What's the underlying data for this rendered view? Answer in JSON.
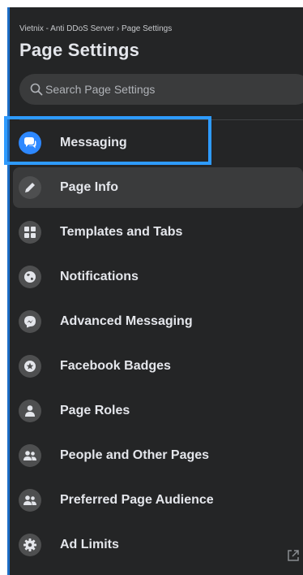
{
  "header": {
    "breadcrumb": "Vietnix - Anti DDoS Server › Page Settings",
    "title": "Page Settings"
  },
  "search": {
    "placeholder": "Search Page Settings"
  },
  "sidebar": {
    "items": [
      {
        "label": "Messaging",
        "icon": "messenger-chat-icon",
        "active": true
      },
      {
        "label": "Page Info",
        "icon": "pencil-icon"
      },
      {
        "label": "Templates and Tabs",
        "icon": "grid-icon"
      },
      {
        "label": "Notifications",
        "icon": "globe-icon"
      },
      {
        "label": "Advanced Messaging",
        "icon": "messenger-icon"
      },
      {
        "label": "Facebook Badges",
        "icon": "star-badge-icon"
      },
      {
        "label": "Page Roles",
        "icon": "person-icon"
      },
      {
        "label": "People and Other Pages",
        "icon": "people-icon"
      },
      {
        "label": "Preferred Page Audience",
        "icon": "people-icon"
      },
      {
        "label": "Ad Limits",
        "icon": "gear-icon",
        "external": "external-link-icon"
      }
    ]
  },
  "colors": {
    "background": "#242526",
    "accent": "#2d88ff",
    "highlight_border": "#2e9bff",
    "text": "#e4e6eb"
  }
}
